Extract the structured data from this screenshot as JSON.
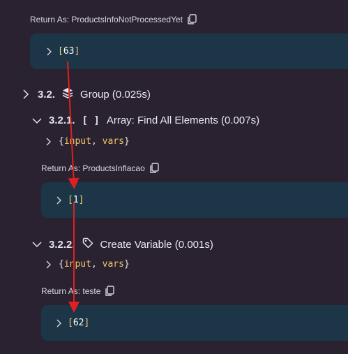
{
  "return1": {
    "label": "Return As: ProductsInfoNotProcessedYet"
  },
  "panel1": {
    "value": "63"
  },
  "group": {
    "step": "3.2.",
    "label": "Group (0.025s)"
  },
  "find": {
    "step": "3.2.1.",
    "label": "Array: Find All Elements (0.007s)",
    "args": [
      "input",
      "vars"
    ]
  },
  "return2": {
    "label": "Return As: ProductsInflacao"
  },
  "panel2": {
    "value": "1"
  },
  "create": {
    "step": "3.2.2.",
    "label": "Create Variable (0.001s)",
    "args": [
      "input",
      "vars"
    ]
  },
  "return3": {
    "label": "Return As: teste"
  },
  "panel3": {
    "value": "62"
  },
  "colors": {
    "background": "#2a2230",
    "panel": "#1c3648",
    "arrow": "#e02020",
    "bracket": "#f2d16a"
  }
}
